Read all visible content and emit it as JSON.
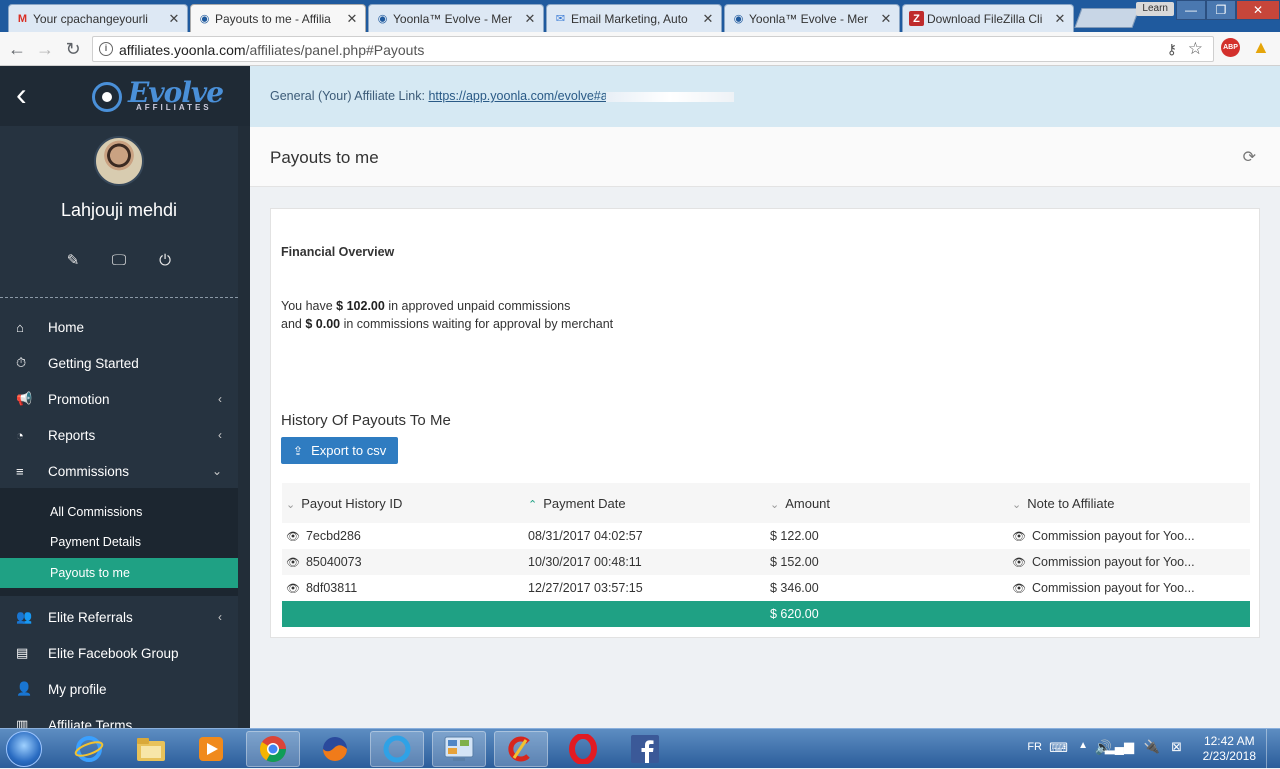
{
  "browser": {
    "tabs": [
      {
        "title": "Your cpachangeyourli",
        "icon": "gmail-icon",
        "active": false
      },
      {
        "title": "Payouts to me - Affilia",
        "icon": "evolve-favicon",
        "active": true
      },
      {
        "title": "Yoonla™ Evolve - Mer",
        "icon": "evolve-favicon",
        "active": false
      },
      {
        "title": "Email Marketing, Auto",
        "icon": "envelope-icon",
        "active": false
      },
      {
        "title": "Yoonla™ Evolve - Mer",
        "icon": "evolve-favicon",
        "active": false
      },
      {
        "title": "Download FileZilla Cli",
        "icon": "filezilla-icon",
        "active": false
      }
    ],
    "learn_label": "Learn",
    "url_host": "affiliates.yoonla.com",
    "url_path": "/affiliates/panel.php#Payouts",
    "abp_label": "ABP"
  },
  "sidebar": {
    "brand": "Evolve",
    "brand_sub": "AFFILIATES",
    "user_name": "Lahjouji mehdi",
    "menu": [
      {
        "label": "Home",
        "icon": "home-icon"
      },
      {
        "label": "Getting Started",
        "icon": "stopwatch-icon"
      },
      {
        "label": "Promotion",
        "icon": "bullhorn-icon"
      },
      {
        "label": "Reports",
        "icon": "pie-chart-icon"
      },
      {
        "label": "Commissions",
        "icon": "list-icon"
      }
    ],
    "submenu": [
      {
        "label": "All Commissions"
      },
      {
        "label": "Payment Details"
      },
      {
        "label": "Payouts to me"
      }
    ],
    "menu2": [
      {
        "label": "Elite Referrals",
        "icon": "users-icon"
      },
      {
        "label": "Elite Facebook Group",
        "icon": "book-icon"
      },
      {
        "label": "My profile",
        "icon": "user-icon"
      },
      {
        "label": "Affiliate Terms",
        "icon": "document-icon"
      }
    ]
  },
  "main": {
    "link_label": "General (Your) Affiliate Link:",
    "link_url": "https://app.yoonla.com/evolve#a",
    "page_title": "Payouts to me",
    "overview_title": "Financial Overview",
    "overview": {
      "line1_pre": "You have",
      "approved_amount": "$ 102.00",
      "line1_post": "in approved unpaid commissions",
      "line2_pre": "and",
      "waiting_amount": "$ 0.00",
      "line2_post": "in commissions waiting for approval by merchant"
    },
    "history_title": "History Of Payouts To Me",
    "export_label": "Export to csv",
    "table": {
      "headers": [
        "Payout History ID",
        "Payment Date",
        "Amount",
        "Note to Affiliate"
      ],
      "rows": [
        {
          "id": "7ecbd286",
          "date": "08/31/2017 04:02:57",
          "amount": "$ 122.00",
          "note": "Commission payout for Yoo..."
        },
        {
          "id": "85040073",
          "date": "10/30/2017 00:48:11",
          "amount": "$ 152.00",
          "note": "Commission payout for Yoo..."
        },
        {
          "id": "8df03811",
          "date": "12/27/2017 03:57:15",
          "amount": "$ 346.00",
          "note": "Commission payout for Yoo..."
        }
      ],
      "total": "$ 620.00"
    }
  },
  "taskbar": {
    "lang": "FR",
    "time": "12:42 AM",
    "date": "2/23/2018"
  }
}
